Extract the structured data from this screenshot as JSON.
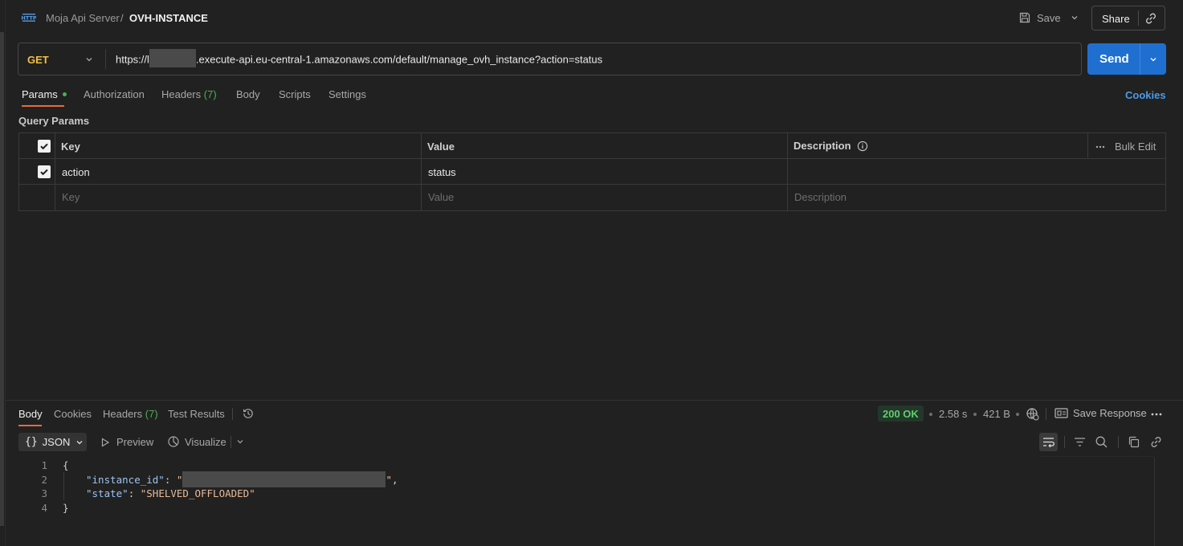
{
  "header": {
    "collection": "Moja Api Server",
    "separator": "/",
    "request_name": "OVH-INSTANCE",
    "save_label": "Save",
    "share_label": "Share"
  },
  "request": {
    "method": "GET",
    "url_prefix": "https://l",
    "url_suffix": ".execute-api.eu-central-1.amazonaws.com/default/manage_ovh_instance?action=status",
    "send_label": "Send"
  },
  "request_tabs": {
    "params": "Params",
    "authorization": "Authorization",
    "headers": "Headers",
    "headers_count": "(7)",
    "body": "Body",
    "scripts": "Scripts",
    "settings": "Settings",
    "cookies": "Cookies"
  },
  "query_params": {
    "title": "Query Params",
    "columns": {
      "key": "Key",
      "value": "Value",
      "description": "Description"
    },
    "bulk_edit": "Bulk Edit",
    "rows": [
      {
        "key": "action",
        "value": "status",
        "description": ""
      }
    ],
    "placeholders": {
      "key": "Key",
      "value": "Value",
      "description": "Description"
    }
  },
  "response_tabs": {
    "body": "Body",
    "cookies": "Cookies",
    "headers": "Headers",
    "headers_count": "(7)",
    "test_results": "Test Results"
  },
  "response_meta": {
    "status": "200 OK",
    "time": "2.58 s",
    "size": "421 B",
    "save_response": "Save Response"
  },
  "response_toolbar": {
    "format": "JSON",
    "preview": "Preview",
    "visualize": "Visualize"
  },
  "response_body": {
    "line_numbers": [
      "1",
      "2",
      "3",
      "4"
    ],
    "open_brace": "{",
    "close_brace": "}",
    "key_instance_id": "\"instance_id\"",
    "key_state": "\"state\"",
    "state_value": "\"SHELVED_OFFLOADED\""
  },
  "colors": {
    "accent_orange": "#e86a3a",
    "send_blue": "#1f6fd1",
    "status_green": "#5fcf6b",
    "method_yellow": "#f0c040"
  }
}
